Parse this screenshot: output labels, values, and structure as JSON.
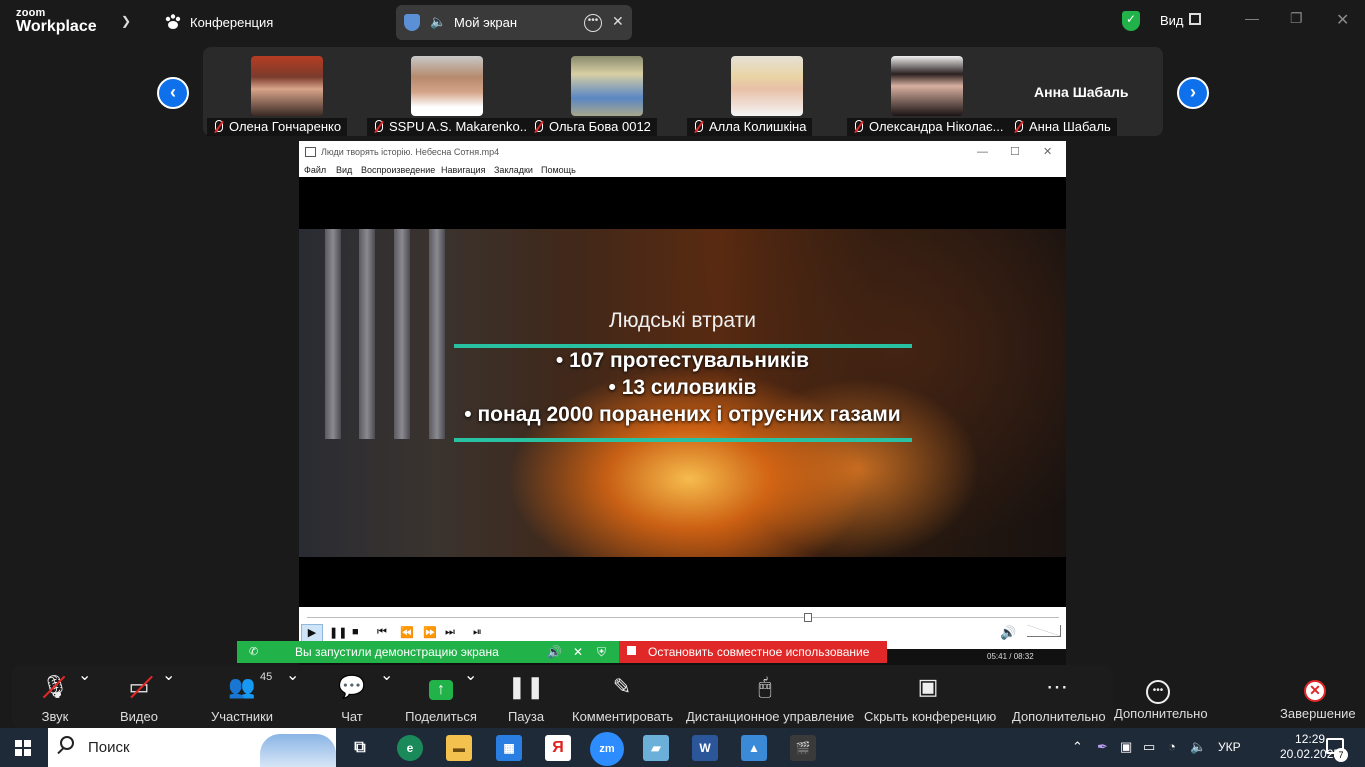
{
  "app": {
    "brand_small": "zoom",
    "brand_big": "Workplace"
  },
  "topbar": {
    "conference_label": "Конференция",
    "my_screen_label": "Мой экран",
    "view_label": "Вид"
  },
  "participants": [
    {
      "name": "Олена Гончаренко"
    },
    {
      "name": "SSPU A.S. Makarenko..."
    },
    {
      "name": "Ольга Бова 0012"
    },
    {
      "name": "Алла Колишкіна"
    },
    {
      "name": "Олександра Ніколає..."
    },
    {
      "name": "Анна Шабаль"
    }
  ],
  "featured_name": "Анна Шабаль",
  "player": {
    "title": "Люди творять історію. Небесна Сотня.mp4",
    "menu": [
      "Файл",
      "Вид",
      "Воспроизведение",
      "Навигация",
      "Закладки",
      "Помощь"
    ],
    "time": "05:41 / 08:32",
    "progress": 0.666
  },
  "video": {
    "heading": "Людські втрати",
    "lines": [
      "• 107 протестувальників",
      "• 13 силовиків",
      "• понад 2000 поранених і отруєних газами"
    ],
    "accent": "#28c2a2"
  },
  "share_banner": {
    "status": "Вы запустили демонстрацию экрана",
    "stop": "Остановить совместное использование",
    "green": "#21b24a",
    "red": "#e02828"
  },
  "toolbar": {
    "audio": "Звук",
    "video": "Видео",
    "participants": "Участники",
    "participants_count": "45",
    "chat": "Чат",
    "share": "Поделиться",
    "pause": "Пауза",
    "annotate": "Комментировать",
    "remote": "Дистанционное управление",
    "hide": "Скрыть конференцию",
    "more": "Дополнительно",
    "more_outside": "Дополнительно",
    "end": "Завершение"
  },
  "taskbar": {
    "search": "Поиск",
    "lang": "УКР",
    "time": "12:29",
    "date": "20.02.2025",
    "notifications": "7"
  },
  "icons": [
    "windows-start-icon",
    "search-icon",
    "task-view-icon",
    "edge-icon",
    "file-explorer-icon",
    "store-icon",
    "yandex-icon",
    "zoom-icon",
    "notes-icon",
    "word-icon",
    "photos-icon",
    "clapper-icon"
  ]
}
